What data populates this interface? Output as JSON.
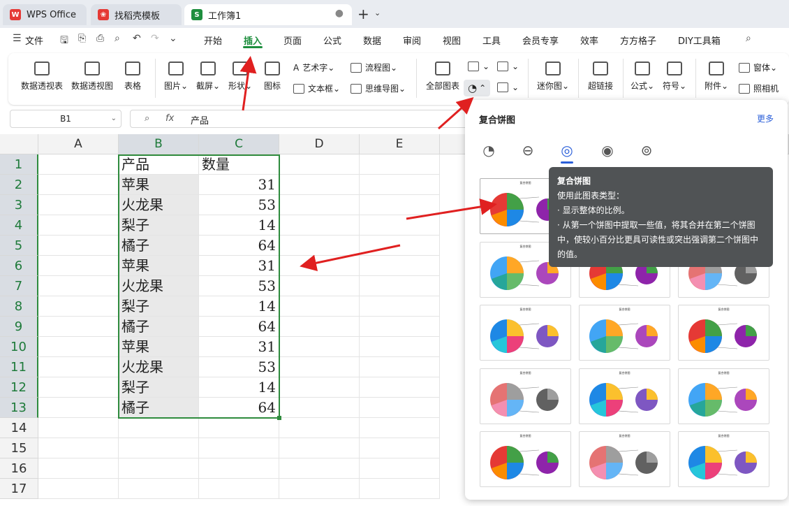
{
  "tabs": [
    {
      "label": "WPS Office"
    },
    {
      "label": "找稻壳模板"
    },
    {
      "label": "工作簿1"
    }
  ],
  "menubar": {
    "file": "文件",
    "items": [
      "开始",
      "插入",
      "页面",
      "公式",
      "数据",
      "审阅",
      "视图",
      "工具",
      "会员专享",
      "效率",
      "方方格子",
      "DIY工具箱"
    ],
    "active": "插入"
  },
  "ribbon": {
    "pivot_table": "数据透视表",
    "pivot_chart": "数据透视图",
    "table": "表格",
    "picture": "图片",
    "screenshot": "截屏",
    "shapes": "形状",
    "icons": "图标",
    "wordart": "艺术字",
    "textbox": "文本框",
    "flowchart": "流程图",
    "mindmap": "思维导图",
    "all_charts": "全部图表",
    "sparkline": "迷你图",
    "hyperlink": "超链接",
    "formula": "公式",
    "symbol": "符号",
    "attachment": "附件",
    "form": "窗体",
    "camera": "照相机"
  },
  "formula_bar": {
    "name_box": "B1",
    "fx": "fx",
    "content": "产品"
  },
  "columns": [
    "A",
    "B",
    "C",
    "D",
    "E"
  ],
  "rows": [
    "1",
    "2",
    "3",
    "4",
    "5",
    "6",
    "7",
    "8",
    "9",
    "10",
    "11",
    "12",
    "13",
    "14",
    "15",
    "16",
    "17"
  ],
  "table": {
    "headers": [
      "产品",
      "数量"
    ],
    "data": [
      [
        "苹果",
        "31"
      ],
      [
        "火龙果",
        "53"
      ],
      [
        "梨子",
        "14"
      ],
      [
        "橘子",
        "64"
      ],
      [
        "苹果",
        "31"
      ],
      [
        "火龙果",
        "53"
      ],
      [
        "梨子",
        "14"
      ],
      [
        "橘子",
        "64"
      ],
      [
        "苹果",
        "31"
      ],
      [
        "火龙果",
        "53"
      ],
      [
        "梨子",
        "14"
      ],
      [
        "橘子",
        "64"
      ]
    ]
  },
  "popup": {
    "title": "复合饼图",
    "more": "更多",
    "thumbnails": [
      "复合饼图",
      "复合饼图",
      "复合饼图",
      "复合饼图",
      "复合饼图",
      "复合饼图",
      "复合饼图",
      "复合饼图",
      "复合饼图",
      "复合饼图",
      "复合饼图",
      "复合饼图",
      "复合饼图",
      "复合饼图",
      "复合饼图"
    ]
  },
  "tooltip": {
    "title": "复合饼图",
    "lines": [
      "使用此图表类型：",
      "· 显示整体的比例。",
      "· 从第一个饼图中提取一些值，将其合并在第二个饼图",
      "中，使较小百分比更具可读性或突出强调第二个饼图中",
      "的值。"
    ]
  },
  "colors": {
    "accent": "#1e8e3e",
    "selection": "#2e8b3d",
    "link": "#2b5fd9",
    "arrow": "#e02020"
  }
}
